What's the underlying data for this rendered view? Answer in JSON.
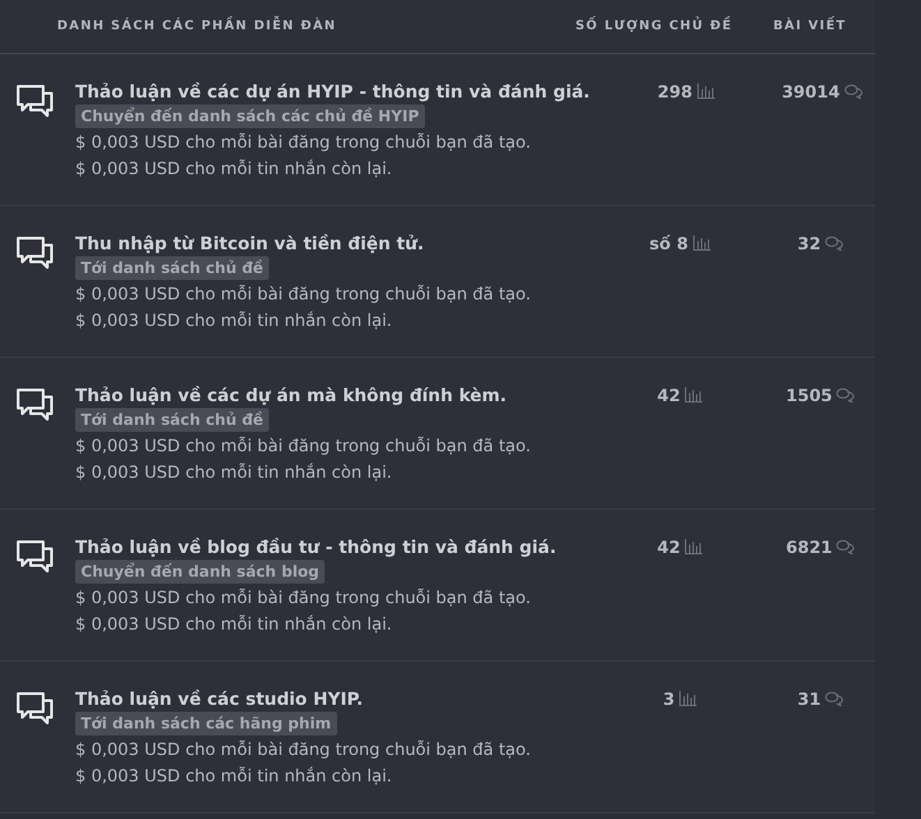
{
  "header": {
    "title": "DANH SÁCH CÁC PHẦN DIỄN ĐÀN",
    "topics": "SỐ LƯỢNG CHỦ ĐỀ",
    "posts": "BÀI VIẾT"
  },
  "forums": [
    {
      "title": "Thảo luận về các dự án HYIP - thông tin và đánh giá.",
      "link": "Chuyển đến danh sách các chủ đề HYIP",
      "notes": [
        "$ 0,003 USD cho mỗi bài đăng trong chuỗi bạn đã tạo.",
        "$ 0,003 USD cho mỗi tin nhắn còn lại."
      ],
      "topics": "298",
      "posts": "39014"
    },
    {
      "title": "Thu nhập từ Bitcoin và tiền điện tử.",
      "link": "Tới danh sách chủ đề",
      "notes": [
        "$ 0,003 USD cho mỗi bài đăng trong chuỗi bạn đã tạo.",
        "$ 0,003 USD cho mỗi tin nhắn còn lại."
      ],
      "topics": "số 8",
      "posts": "32"
    },
    {
      "title": "Thảo luận về các dự án mà không đính kèm.",
      "link": "Tới danh sách chủ đề",
      "notes": [
        "$ 0,003 USD cho mỗi bài đăng trong chuỗi bạn đã tạo.",
        "$ 0,003 USD cho mỗi tin nhắn còn lại."
      ],
      "topics": "42",
      "posts": "1505"
    },
    {
      "title": "Thảo luận về blog đầu tư - thông tin và đánh giá.",
      "link": "Chuyển đến danh sách blog",
      "notes": [
        "$ 0,003 USD cho mỗi bài đăng trong chuỗi bạn đã tạo.",
        "$ 0,003 USD cho mỗi tin nhắn còn lại."
      ],
      "topics": "42",
      "posts": "6821"
    },
    {
      "title": "Thảo luận về các studio HYIP.",
      "link": "Tới danh sách các hãng phim",
      "notes": [
        "$ 0,003 USD cho mỗi bài đăng trong chuỗi bạn đã tạo.",
        "$ 0,003 USD cho mỗi tin nhắn còn lại."
      ],
      "topics": "3",
      "posts": "31"
    }
  ]
}
